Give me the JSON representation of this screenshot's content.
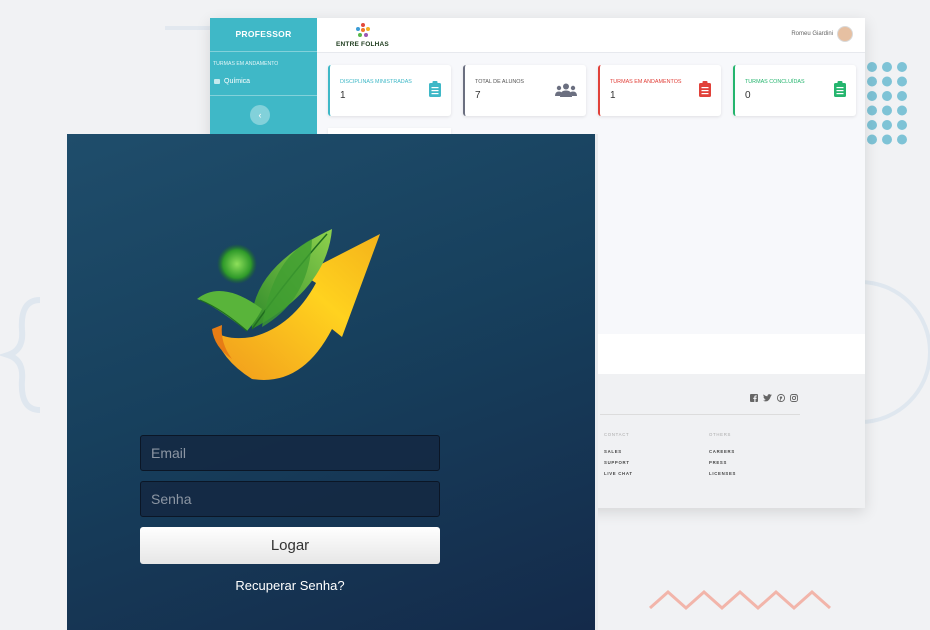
{
  "dashboard": {
    "sidebar": {
      "title": "PROFESSOR",
      "section": "TURMAS EM ANDAMENTO",
      "items": [
        {
          "label": "Química"
        }
      ],
      "collapse_icon": "chevron-left-icon"
    },
    "brand": {
      "text": "ENTRE FOLHAS"
    },
    "user": {
      "name": "Romeu Giardini"
    },
    "stats": [
      {
        "label": "DISCIPLINAS MINISTRADAS",
        "value": "1",
        "icon": "clipboard-icon",
        "color": "#3fb8c7"
      },
      {
        "label": "TOTAL DE ALUNOS",
        "value": "7",
        "icon": "users-icon",
        "color": "#6b6f80"
      },
      {
        "label": "TURMAS EM ANDAMENTOS",
        "value": "1",
        "icon": "clipboard-icon",
        "color": "#e1413a"
      },
      {
        "label": "TURMAS CONCLUÍDAS",
        "value": "0",
        "icon": "clipboard-icon",
        "color": "#25b56e"
      }
    ],
    "footer": {
      "social": [
        "facebook-icon",
        "twitter-icon",
        "pinterest-icon",
        "instagram-icon"
      ],
      "contact": {
        "heading": "CONTACT",
        "links": [
          "SALES",
          "SUPPORT",
          "LIVE CHAT"
        ]
      },
      "others": {
        "heading": "OTHERS",
        "links": [
          "CAREERS",
          "PRESS",
          "LICENSES"
        ]
      }
    }
  },
  "login": {
    "email_placeholder": "Email",
    "password_placeholder": "Senha",
    "button_label": "Logar",
    "recover_link": "Recuperar Senha?"
  }
}
